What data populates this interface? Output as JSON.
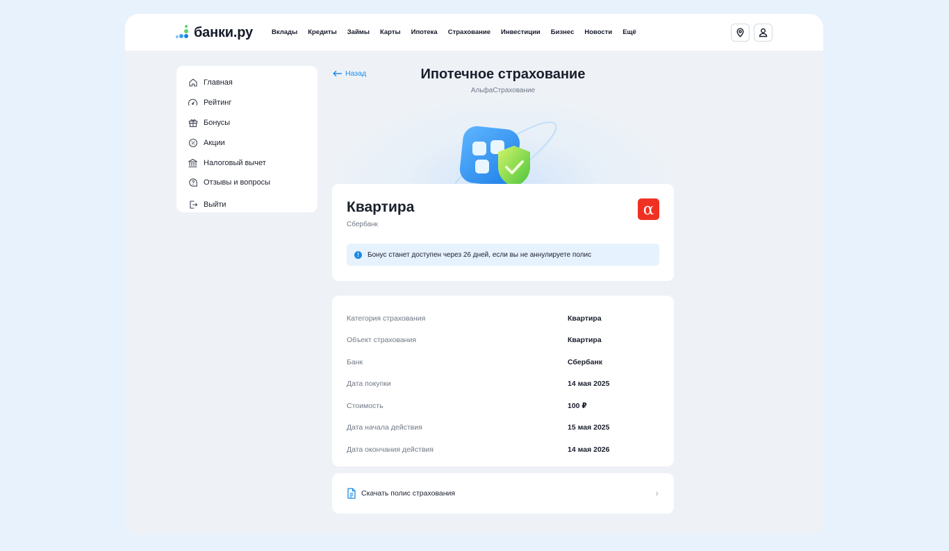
{
  "brand": {
    "logo_text": "банки.ру",
    "accent": "#1a8ae8"
  },
  "nav": [
    "Вклады",
    "Кредиты",
    "Займы",
    "Карты",
    "Ипотека",
    "Страхование",
    "Инвестиции",
    "Бизнес",
    "Новости",
    "Ещё"
  ],
  "header_icons": {
    "location": "location-pin-icon",
    "profile": "user-icon"
  },
  "sidebar": {
    "items": [
      {
        "label": "Главная",
        "icon": "home-icon"
      },
      {
        "label": "Рейтинг",
        "icon": "gauge-icon"
      },
      {
        "label": "Бонусы",
        "icon": "gift-icon"
      },
      {
        "label": "Акции",
        "icon": "percent-icon"
      },
      {
        "label": "Налоговый вычет",
        "icon": "bank-building-icon"
      },
      {
        "label": "Отзывы и вопросы",
        "icon": "question-bubble-icon"
      },
      {
        "label": "Выйти",
        "icon": "logout-icon"
      }
    ]
  },
  "page": {
    "back_label": "Назад",
    "title": "Ипотечное страхование",
    "subtitle": "АльфаСтрахование"
  },
  "policy": {
    "title": "Квартира",
    "subtitle": "Сбербанк",
    "logo_letter": "α",
    "logo_color": "#ef3124",
    "notice": "Бонус станет доступен через 26 дней, если вы не аннулируете полис"
  },
  "details": [
    {
      "key": "Категория страхования",
      "value": "Квартира"
    },
    {
      "key": "Объект страхования",
      "value": "Квартира"
    },
    {
      "key": "Банк",
      "value": "Сбербанк"
    },
    {
      "key": "Дата покупки",
      "value": "14 мая 2025"
    },
    {
      "key": "Стоимость",
      "value": "100 ₽"
    },
    {
      "key": "Дата начала действия",
      "value": "15 мая 2025"
    },
    {
      "key": "Дата окончания действия",
      "value": "14 мая 2026"
    }
  ],
  "download": {
    "label": "Скачать полис страхования",
    "icon": "document-icon"
  }
}
